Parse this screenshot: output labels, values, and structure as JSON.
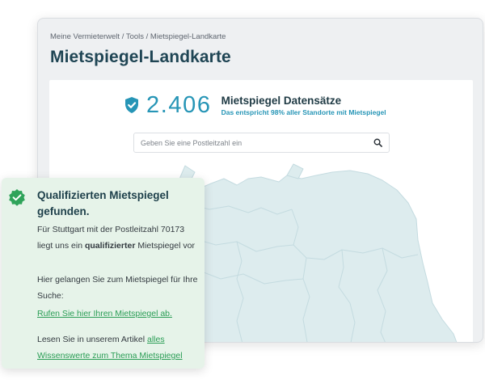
{
  "breadcrumb": {
    "items": [
      "Meine Vermieterwelt",
      "Tools",
      "Mietspiegel-Landkarte"
    ],
    "separator": " / "
  },
  "page_title": "Mietspiegel-Landkarte",
  "stats": {
    "icon": "shield-check-icon",
    "count": "2.406",
    "title": "Mietspiegel Datensätze",
    "subtitle": "Das entspricht 98% aller Standorte mit Mietspiegel"
  },
  "search": {
    "placeholder": "Geben Sie eine Postleitzahl ein",
    "value": "",
    "icon": "search-icon"
  },
  "map": {
    "icon": "germany-map",
    "fill_color": "#ddecee",
    "stroke_color": "#c4dbe0"
  },
  "result": {
    "icon": "check-badge-icon",
    "title": "Qualifizierten Mietspiegel gefunden.",
    "p1_pre": "Für Stuttgart mit der Postleitzahl 70173 liegt uns ein ",
    "p1_bold": "qualifizierter",
    "p1_post": " Mietspiegel vor",
    "p2": "Hier gelangen Sie zum Mietspiegel für Ihre Suche:",
    "link1": "Rufen Sie hier Ihren Mietspiegel ab.",
    "p4_pre": "Lesen Sie in unserem Artikel ",
    "link2": "alles Wissenswerte zum Thema Mietspiegel"
  },
  "colors": {
    "accent": "#2695b6",
    "title": "#1f4554",
    "success_bg": "#e6f3e9",
    "success_icon": "#2fa35a",
    "link": "#2a9d55"
  }
}
